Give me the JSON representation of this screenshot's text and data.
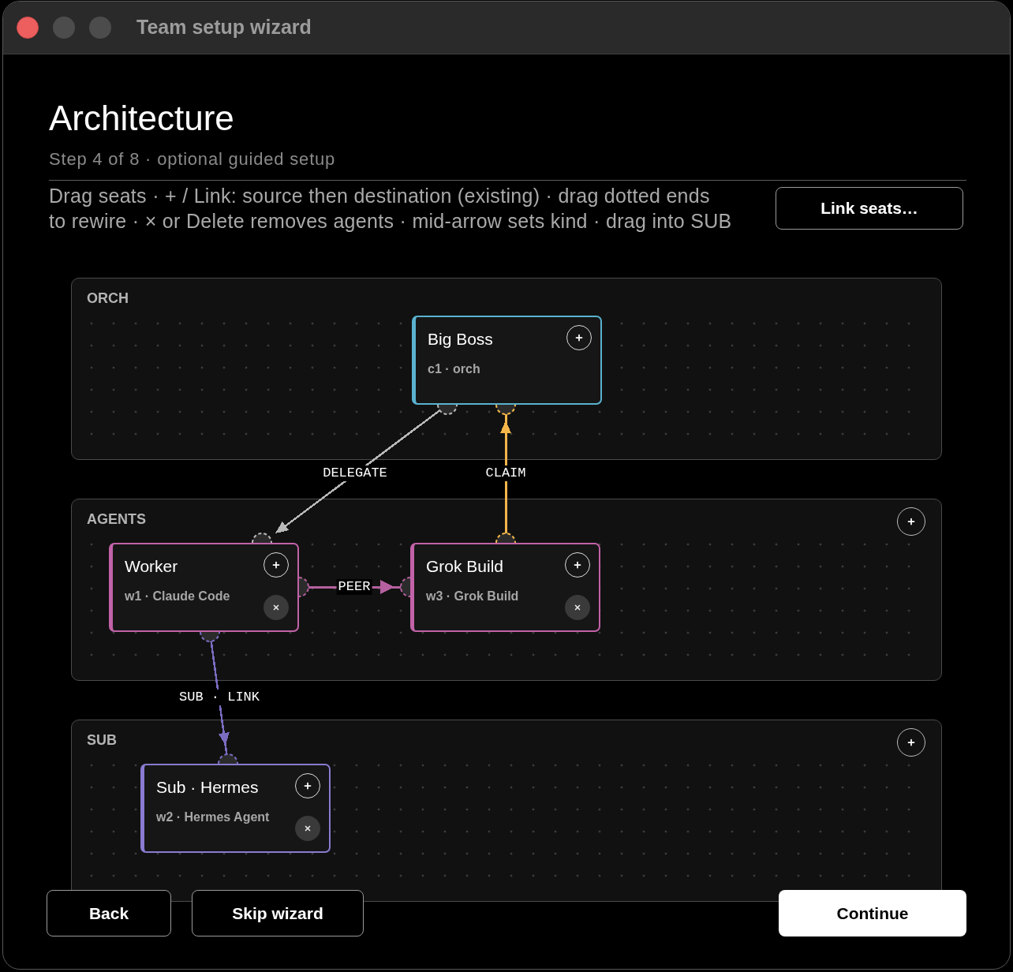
{
  "window": {
    "title": "Team setup wizard"
  },
  "header": {
    "title": "Architecture",
    "step": "Step 4 of 8 · optional guided setup",
    "instructions": "Drag seats · + / Link: source then destination (existing) · drag dotted ends\nto rewire · × or Delete removes agents · mid-arrow sets kind · drag into SUB"
  },
  "link_button": {
    "label": "Link seats…"
  },
  "lanes": [
    {
      "label": "ORCH",
      "addable": false,
      "nodes": [
        {
          "title": "Big Boss",
          "subtitle": "c1 · orch",
          "color": "#59b2cf",
          "removable": false
        }
      ]
    },
    {
      "label": "AGENTS",
      "addable": true,
      "nodes": [
        {
          "title": "Worker",
          "subtitle": "w1 · Claude Code",
          "color": "#c262a8",
          "removable": true
        },
        {
          "title": "Grok Build",
          "subtitle": "w3 · Grok Build",
          "color": "#c262a8",
          "removable": true
        }
      ]
    },
    {
      "label": "SUB",
      "addable": true,
      "nodes": [
        {
          "title": "Sub · Hermes",
          "subtitle": "w2 · Hermes Agent",
          "color": "#8a7bd0",
          "removable": true
        }
      ]
    }
  ],
  "edges": [
    {
      "label": "DELEGATE",
      "color": "#b8b8b8"
    },
    {
      "label": "CLAIM",
      "color": "#f3b54a"
    },
    {
      "label": "PEER",
      "color": "#b5609f"
    },
    {
      "label": "SUB · LINK",
      "color": "#7b6cc0"
    }
  ],
  "footer": {
    "back": "Back",
    "skip": "Skip wizard",
    "continue": "Continue"
  }
}
